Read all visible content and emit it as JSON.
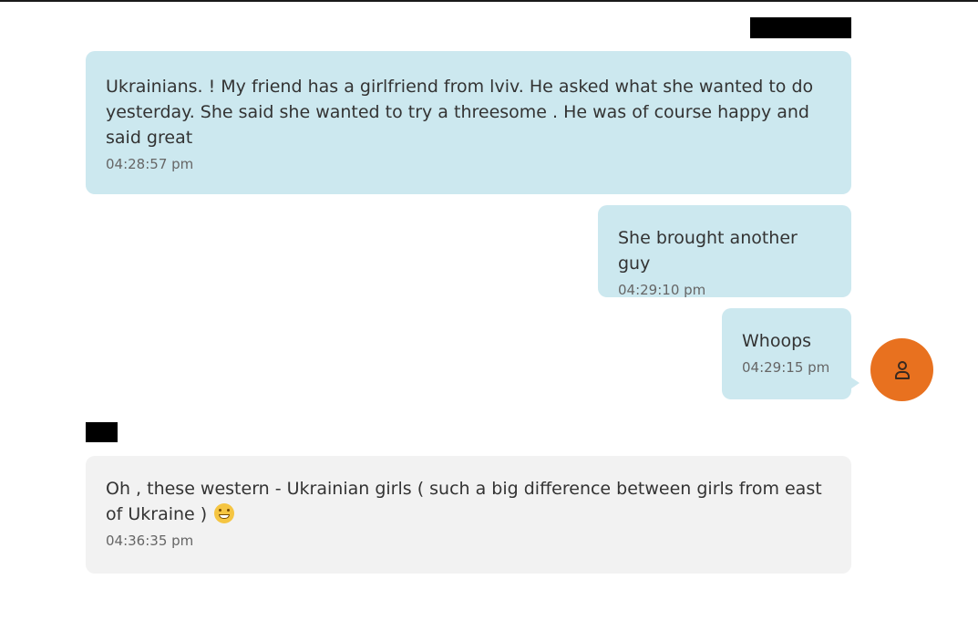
{
  "colors": {
    "sent_bubble": "#cce8ef",
    "received_bubble": "#f2f2f2",
    "avatar": "#e8711f",
    "redaction": "#000000"
  },
  "messages": [
    {
      "direction": "sent",
      "text": "Ukrainians. !  My friend has a girlfriend from lviv. He asked what she wanted to do yesterday. She said she wanted to try a threesome .  He was of course happy and said great",
      "time": "04:28:57 pm"
    },
    {
      "direction": "sent",
      "text": "She brought another guy",
      "time": "04:29:10 pm"
    },
    {
      "direction": "sent",
      "text": "Whoops",
      "time": "04:29:15 pm"
    },
    {
      "direction": "received",
      "text": "Oh , these western - Ukrainian girls ( such a big difference between girls from east of Ukraine )",
      "emoji": "grinning-face-emoji",
      "time": "04:36:35 pm"
    }
  ],
  "avatar": {
    "icon": "person-icon"
  }
}
